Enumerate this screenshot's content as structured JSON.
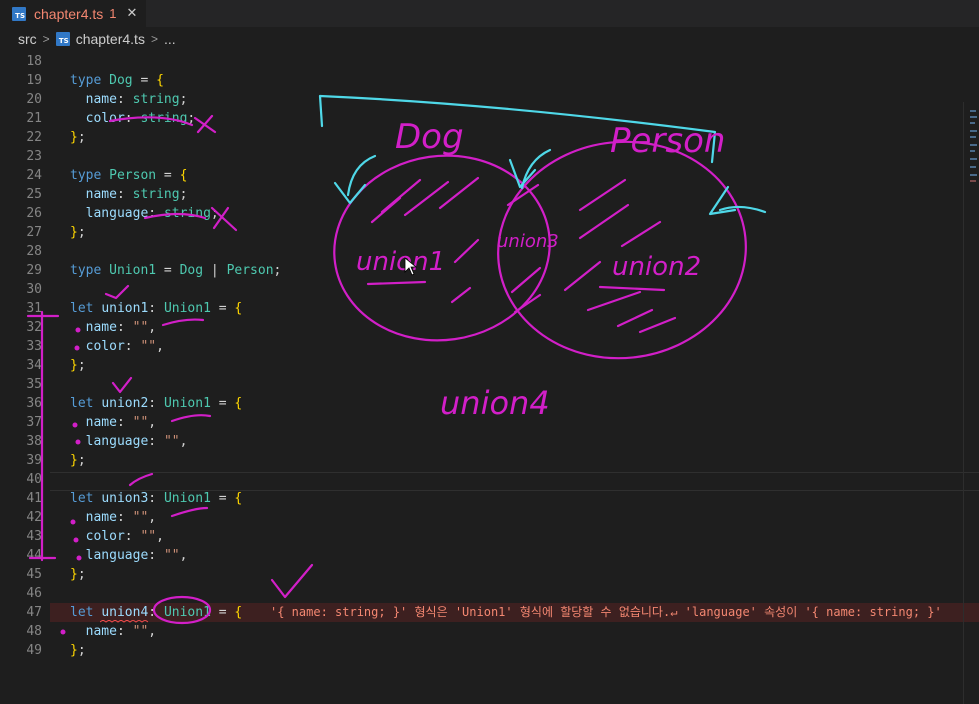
{
  "tab": {
    "icon": "typescript-file-icon",
    "icon_text": "TS",
    "filename": "chapter4.ts",
    "problems": "1",
    "close": "✕"
  },
  "breadcrumb": {
    "folder": "src",
    "file": "chapter4.ts",
    "more": "..."
  },
  "lines": [
    {
      "num": "18",
      "tokens": []
    },
    {
      "num": "19",
      "tokens": [
        [
          "kw",
          "type "
        ],
        [
          "ty",
          "Dog"
        ],
        [
          "p",
          " = "
        ],
        [
          "br",
          "{"
        ]
      ]
    },
    {
      "num": "20",
      "tokens": [
        [
          "p",
          "  "
        ],
        [
          "vr",
          "name"
        ],
        [
          "p",
          ": "
        ],
        [
          "ty",
          "string"
        ],
        [
          "p",
          ";"
        ]
      ]
    },
    {
      "num": "21",
      "tokens": [
        [
          "p",
          "  "
        ],
        [
          "vr",
          "color"
        ],
        [
          "p",
          ": "
        ],
        [
          "ty",
          "string"
        ],
        [
          "p",
          ";"
        ]
      ]
    },
    {
      "num": "22",
      "tokens": [
        [
          "br",
          "}"
        ],
        [
          "p",
          ";"
        ]
      ]
    },
    {
      "num": "23",
      "tokens": []
    },
    {
      "num": "24",
      "tokens": [
        [
          "kw",
          "type "
        ],
        [
          "ty",
          "Person"
        ],
        [
          "p",
          " = "
        ],
        [
          "br",
          "{"
        ]
      ]
    },
    {
      "num": "25",
      "tokens": [
        [
          "p",
          "  "
        ],
        [
          "vr",
          "name"
        ],
        [
          "p",
          ": "
        ],
        [
          "ty",
          "string"
        ],
        [
          "p",
          ";"
        ]
      ]
    },
    {
      "num": "26",
      "tokens": [
        [
          "p",
          "  "
        ],
        [
          "vr",
          "language"
        ],
        [
          "p",
          ": "
        ],
        [
          "ty",
          "string"
        ],
        [
          "p",
          ";"
        ]
      ]
    },
    {
      "num": "27",
      "tokens": [
        [
          "br",
          "}"
        ],
        [
          "p",
          ";"
        ]
      ]
    },
    {
      "num": "28",
      "tokens": []
    },
    {
      "num": "29",
      "tokens": [
        [
          "kw",
          "type "
        ],
        [
          "ty",
          "Union1"
        ],
        [
          "p",
          " = "
        ],
        [
          "ty",
          "Dog"
        ],
        [
          "p",
          " | "
        ],
        [
          "ty",
          "Person"
        ],
        [
          "p",
          ";"
        ]
      ]
    },
    {
      "num": "30",
      "tokens": []
    },
    {
      "num": "31",
      "tokens": [
        [
          "kw",
          "let "
        ],
        [
          "vr",
          "union1"
        ],
        [
          "p",
          ": "
        ],
        [
          "ty",
          "Union1"
        ],
        [
          "p",
          " = "
        ],
        [
          "br",
          "{"
        ]
      ]
    },
    {
      "num": "32",
      "tokens": [
        [
          "p",
          "  "
        ],
        [
          "vr",
          "name"
        ],
        [
          "p",
          ": "
        ],
        [
          "st",
          "\"\""
        ],
        [
          "p",
          ","
        ]
      ]
    },
    {
      "num": "33",
      "tokens": [
        [
          "p",
          "  "
        ],
        [
          "vr",
          "color"
        ],
        [
          "p",
          ": "
        ],
        [
          "st",
          "\"\""
        ],
        [
          "p",
          ","
        ]
      ]
    },
    {
      "num": "34",
      "tokens": [
        [
          "br",
          "}"
        ],
        [
          "p",
          ";"
        ]
      ]
    },
    {
      "num": "35",
      "tokens": []
    },
    {
      "num": "36",
      "tokens": [
        [
          "kw",
          "let "
        ],
        [
          "vr",
          "union2"
        ],
        [
          "p",
          ": "
        ],
        [
          "ty",
          "Union1"
        ],
        [
          "p",
          " = "
        ],
        [
          "br",
          "{"
        ]
      ]
    },
    {
      "num": "37",
      "tokens": [
        [
          "p",
          "  "
        ],
        [
          "vr",
          "name"
        ],
        [
          "p",
          ": "
        ],
        [
          "st",
          "\"\""
        ],
        [
          "p",
          ","
        ]
      ]
    },
    {
      "num": "38",
      "tokens": [
        [
          "p",
          "  "
        ],
        [
          "vr",
          "language"
        ],
        [
          "p",
          ": "
        ],
        [
          "st",
          "\"\""
        ],
        [
          "p",
          ","
        ]
      ]
    },
    {
      "num": "39",
      "tokens": [
        [
          "br",
          "}"
        ],
        [
          "p",
          ";"
        ]
      ]
    },
    {
      "num": "40",
      "tokens": []
    },
    {
      "num": "41",
      "tokens": [
        [
          "kw",
          "let "
        ],
        [
          "vr",
          "union3"
        ],
        [
          "p",
          ": "
        ],
        [
          "ty",
          "Union1"
        ],
        [
          "p",
          " = "
        ],
        [
          "br",
          "{"
        ]
      ]
    },
    {
      "num": "42",
      "tokens": [
        [
          "p",
          "  "
        ],
        [
          "vr",
          "name"
        ],
        [
          "p",
          ": "
        ],
        [
          "st",
          "\"\""
        ],
        [
          "p",
          ","
        ]
      ]
    },
    {
      "num": "43",
      "tokens": [
        [
          "p",
          "  "
        ],
        [
          "vr",
          "color"
        ],
        [
          "p",
          ": "
        ],
        [
          "st",
          "\"\""
        ],
        [
          "p",
          ","
        ]
      ]
    },
    {
      "num": "44",
      "tokens": [
        [
          "p",
          "  "
        ],
        [
          "vr",
          "language"
        ],
        [
          "p",
          ": "
        ],
        [
          "st",
          "\"\""
        ],
        [
          "p",
          ","
        ]
      ]
    },
    {
      "num": "45",
      "tokens": [
        [
          "br",
          "}"
        ],
        [
          "p",
          ";"
        ]
      ]
    },
    {
      "num": "46",
      "tokens": []
    },
    {
      "num": "47",
      "tokens": [
        [
          "kw",
          "let "
        ],
        [
          "vr",
          "union4"
        ],
        [
          "p",
          ": "
        ],
        [
          "ty",
          "Union1"
        ],
        [
          "p",
          " = "
        ],
        [
          "br",
          "{"
        ]
      ]
    },
    {
      "num": "48",
      "tokens": [
        [
          "p",
          "  "
        ],
        [
          "vr",
          "name"
        ],
        [
          "p",
          ": "
        ],
        [
          "st",
          "\"\""
        ],
        [
          "p",
          ","
        ]
      ]
    },
    {
      "num": "49",
      "tokens": [
        [
          "br",
          "}"
        ],
        [
          "p",
          ";"
        ]
      ]
    }
  ],
  "error_message": "'{ name: string; }' 형식은 'Union1' 형식에 할당할 수 없습니다.↵ 'language' 속성이 '{ name: string; }'",
  "annotations": {
    "dog": "Dog",
    "person": "Person",
    "union1": "union1",
    "union2": "union2",
    "union3": "union3",
    "union4": "union4"
  },
  "colors": {
    "ink_magenta": "#d21fc8",
    "ink_cyan": "#4fd8e8",
    "error_red": "#f48771",
    "ts_blue": "#3178c6"
  }
}
